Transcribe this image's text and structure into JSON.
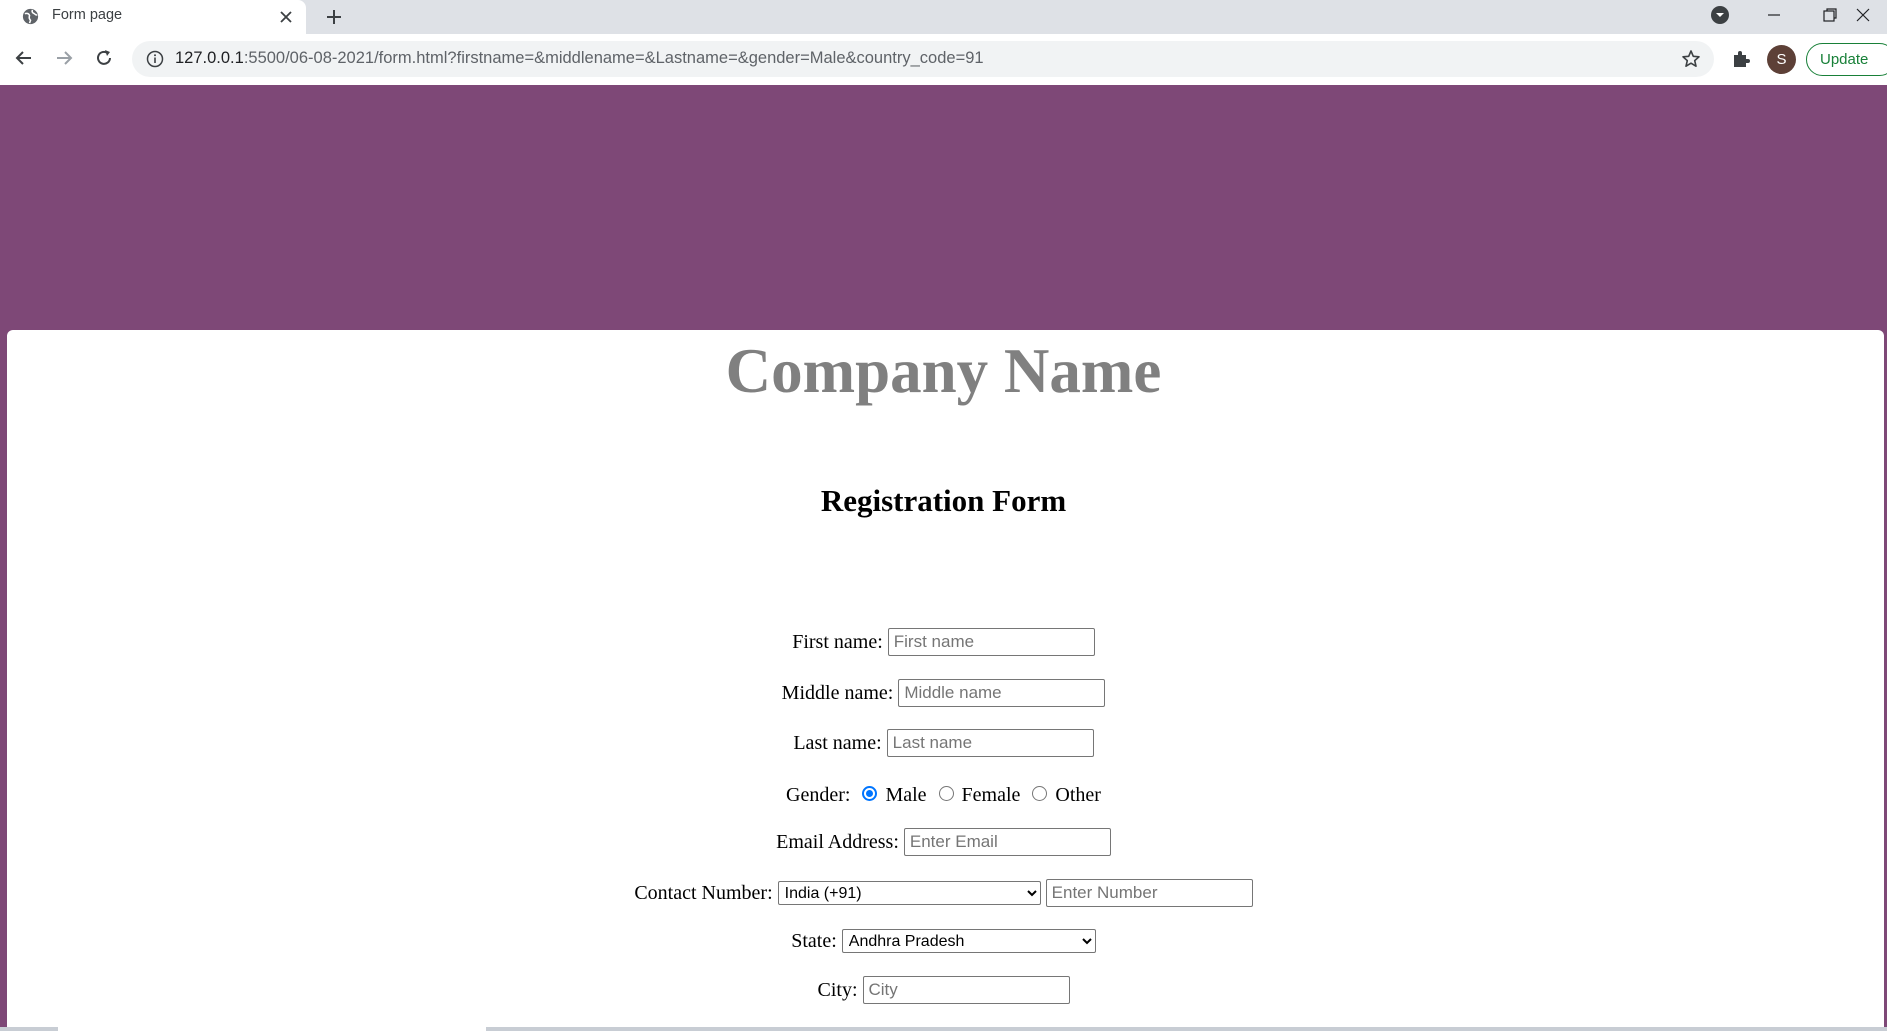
{
  "browser": {
    "tab_title": "Form page",
    "url_host": "127.0.0.1",
    "url_rest": ":5500/06-08-2021/form.html?firstname=&middlename=&Lastname=&gender=Male&country_code=91",
    "profile_initial": "S",
    "update_label": "Update"
  },
  "page": {
    "company_name": "Company Name",
    "form_title": "Registration Form",
    "first_name_label": "First name:",
    "first_name_placeholder": "First name",
    "middle_name_label": "Middle name:",
    "middle_name_placeholder": "Middle name",
    "last_name_label": "Last name:",
    "last_name_placeholder": "Last name",
    "gender_label": "Gender:",
    "gender_options": [
      "Male",
      "Female",
      "Other"
    ],
    "gender_selected": "Male",
    "email_label": "Email Address:",
    "email_placeholder": "Enter Email",
    "contact_label": "Contact Number:",
    "country_code_selected": "India (+91)",
    "contact_placeholder": "Enter Number",
    "state_label": "State:",
    "state_selected": "Andhra Pradesh",
    "city_label": "City:",
    "city_placeholder": "City"
  },
  "colors": {
    "header_purple": "#7e4877",
    "company_gray": "#808080",
    "radio_accent": "#0075ff"
  }
}
